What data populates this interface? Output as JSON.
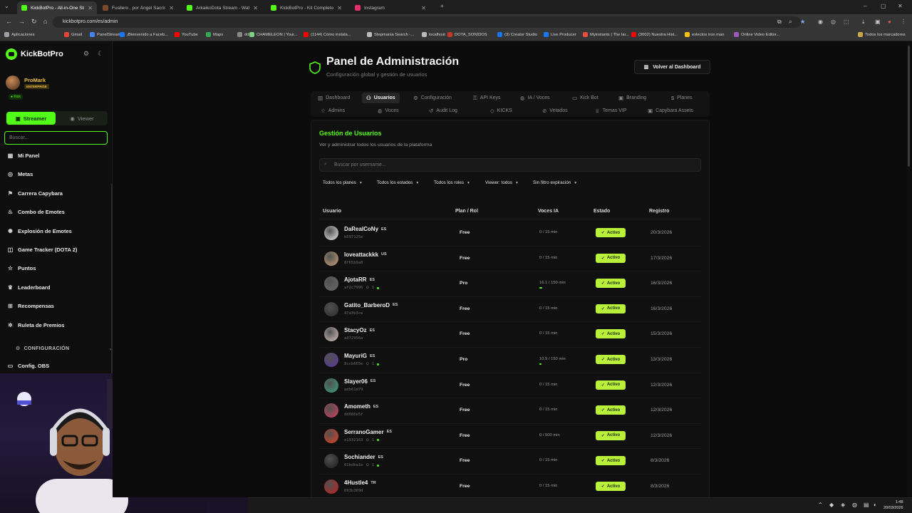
{
  "browser": {
    "tabs": [
      {
        "title": "KickBotPro - All-in-One Stream...",
        "color": "#53fc18",
        "active": true
      },
      {
        "title": "Fusilero , por Ángel Sacristán ...",
        "color": "#7a4b2a",
        "active": false
      },
      {
        "title": "ArkaikoDota Stream - Watch Li...",
        "color": "#53fc18",
        "active": false
      },
      {
        "title": "KickBotPro - Kit Completo de ...",
        "color": "#53fc18",
        "active": false
      },
      {
        "title": "Instagram",
        "color": "#e1306c",
        "active": false
      }
    ],
    "url": "kickbotpro.com/es/admin",
    "bookmarks": [
      {
        "label": "Aplicaciones",
        "color": "#9aa0a6"
      },
      {
        "label": "Gmail",
        "color": "#ea4335"
      },
      {
        "label": "PanelStream",
        "color": "#4285f4"
      },
      {
        "label": "¡Bienvenido a Faceb...",
        "color": "#1877f2"
      },
      {
        "label": "YouTube",
        "color": "#ff0000"
      },
      {
        "label": "Maps",
        "color": "#34a853"
      },
      {
        "label": "ddr",
        "color": "#888888"
      },
      {
        "label": "CHAMELEON | Your...",
        "color": "#7bd389"
      },
      {
        "label": "(1144) Cómo instala...",
        "color": "#ff0000"
      },
      {
        "label": "Stepmania Search -...",
        "color": "#bbbbbb"
      },
      {
        "label": "localhost",
        "color": "#bbbbbb"
      },
      {
        "label": "DOTA_SONIDOS",
        "color": "#c0392b"
      },
      {
        "label": "(3) Creator Studio",
        "color": "#1877f2"
      },
      {
        "label": "Live Producer",
        "color": "#1877f2"
      },
      {
        "label": "Myinstants | The lar...",
        "color": "#e74c3c"
      },
      {
        "label": "(3002) Nuestra Hist...",
        "color": "#ff0000"
      },
      {
        "label": "evlectos iron man",
        "color": "#f1c40f"
      },
      {
        "label": "Online Video Editor...",
        "color": "#9b59b6"
      }
    ],
    "all_bookmarks": "Todos los marcadores"
  },
  "sidebar": {
    "brand": "KickBotPro",
    "profile": {
      "name": "ProMark",
      "plan": "ENTERPRISE",
      "platform": "Kick"
    },
    "mode": {
      "streamer": "Streamer",
      "viewer": "Viewer"
    },
    "search_placeholder": "Buscar...",
    "items": [
      {
        "label": "Mi Panel",
        "icon": "grid-icon"
      },
      {
        "label": "Metas",
        "icon": "target-icon"
      },
      {
        "label": "Carrera Capybara",
        "icon": "race-icon"
      },
      {
        "label": "Combo de Emotes",
        "icon": "flame-icon"
      },
      {
        "label": "Explosión de Emotes",
        "icon": "burst-icon"
      },
      {
        "label": "Game Tracker (DOTA 2)",
        "icon": "gamepad-icon"
      },
      {
        "label": "Puntos",
        "icon": "star-icon"
      },
      {
        "label": "Leaderboard",
        "icon": "trophy-icon"
      },
      {
        "label": "Recompensas",
        "icon": "gift-icon"
      },
      {
        "label": "Ruleta de Premios",
        "icon": "wheel-icon"
      }
    ],
    "config_section": "CONFIGURACIÓN",
    "config_obs": "Config. OBS"
  },
  "header": {
    "title": "Panel de Administración",
    "subtitle": "Configuración global y gestión de usuarios",
    "back_button": "Volver al Dashboard"
  },
  "tabs_row1": [
    {
      "label": "Dashboard",
      "active": false
    },
    {
      "label": "Usuarios",
      "active": true
    },
    {
      "label": "Configuración",
      "active": false
    },
    {
      "label": "API Keys",
      "active": false
    },
    {
      "label": "IA / Voces",
      "active": false
    },
    {
      "label": "Kick Bot",
      "active": false
    },
    {
      "label": "Branding",
      "active": false
    },
    {
      "label": "Planes",
      "active": false
    }
  ],
  "tabs_row2": [
    {
      "label": "Admins"
    },
    {
      "label": "Voces"
    },
    {
      "label": "Audit Log"
    },
    {
      "label": "KICKS"
    },
    {
      "label": "Vetados"
    },
    {
      "label": "Temas VIP"
    },
    {
      "label": "Capybara Assets"
    }
  ],
  "users_panel": {
    "title": "Gestión de Usuarios",
    "subtitle": "Ver y administrar todos los usuarios de la plataforma",
    "search_placeholder": "Buscar por username...",
    "filters": [
      "Todos los planes",
      "Todos los estados",
      "Todos los roles",
      "Viewer: todos",
      "Sin filtro expiración"
    ],
    "columns": [
      "Usuario",
      "Plan / Rol",
      "Voces IA",
      "Estado",
      "Registro"
    ],
    "rows": [
      {
        "name": "DaRealCoNy",
        "lang": "ES",
        "id": "b597125e",
        "conn": "",
        "plan": "Free",
        "voices": "0 / 15 min",
        "usage": 0,
        "status": "Activo",
        "date": "20/3/2026",
        "avatar": "#e8e8e8"
      },
      {
        "name": "loveattackkk",
        "lang": "US",
        "id": "8f65b9a0",
        "conn": "",
        "plan": "Free",
        "voices": "0 / 15 min",
        "usage": 0,
        "status": "Activo",
        "date": "17/3/2026",
        "avatar": "#c9a07a"
      },
      {
        "name": "AjotaRR",
        "lang": "ES",
        "id": "af2c7996",
        "conn": "1",
        "plan": "Pro",
        "voices": "16.1 / 150 min",
        "usage": 0.107,
        "status": "Activo",
        "date": "16/3/2026",
        "avatar": "#6b6b6b"
      },
      {
        "name": "Gatito_BarberoD",
        "lang": "ES",
        "id": "47d3b3ce",
        "conn": "",
        "plan": "Free",
        "voices": "0 / 15 min",
        "usage": 0,
        "status": "Activo",
        "date": "16/3/2026",
        "avatar": "#2a2a2a"
      },
      {
        "name": "StacyOz",
        "lang": "ES",
        "id": "a372956a",
        "conn": "",
        "plan": "Free",
        "voices": "0 / 15 min",
        "usage": 0,
        "status": "Activo",
        "date": "15/3/2026",
        "avatar": "#d8c0c0"
      },
      {
        "name": "MayuriG",
        "lang": "ES",
        "id": "8ccb665e",
        "conn": "1",
        "plan": "Pro",
        "voices": "10.9 / 150 min",
        "usage": 0.073,
        "status": "Activo",
        "date": "13/3/2026",
        "avatar": "#5a3aa0"
      },
      {
        "name": "Slayer06",
        "lang": "ES",
        "id": "adb61d79",
        "conn": "",
        "plan": "Free",
        "voices": "0 / 15 min",
        "usage": 0,
        "status": "Activo",
        "date": "12/3/2026",
        "avatar": "#3aa080"
      },
      {
        "name": "Amometh",
        "lang": "ES",
        "id": "dd086e5f",
        "conn": "",
        "plan": "Free",
        "voices": "0 / 15 min",
        "usage": 0,
        "status": "Activo",
        "date": "12/3/2026",
        "avatar": "#d04060"
      },
      {
        "name": "SerranoGamer",
        "lang": "ES",
        "id": "e1932163",
        "conn": "1",
        "plan": "Free",
        "voices": "0 / 500 min",
        "usage": 0,
        "status": "Activo",
        "date": "12/3/2026",
        "avatar": "#e04020"
      },
      {
        "name": "Sochiander",
        "lang": "ES",
        "id": "01bdba1b",
        "conn": "1",
        "plan": "Free",
        "voices": "0 / 15 min",
        "usage": 0,
        "status": "Activo",
        "date": "8/3/2026",
        "avatar": "#1a1a1a"
      },
      {
        "name": "4Hustle4",
        "lang": "TR",
        "id": "693b369d",
        "conn": "",
        "plan": "Free",
        "voices": "0 / 15 min",
        "usage": 0,
        "status": "Activo",
        "date": "8/3/2026",
        "avatar": "#c02020"
      }
    ]
  },
  "taskbar": {
    "time": "1:48",
    "date": "20/03/2026"
  },
  "colors": {
    "accent": "#53fc18",
    "badge": "#b9f03a",
    "background": "#0b0b0b",
    "gold": "#f0c040"
  }
}
